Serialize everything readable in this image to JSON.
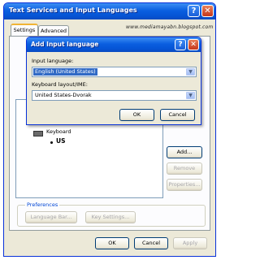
{
  "main_window": {
    "title": "Text Services and Input Languages",
    "help_glyph": "?",
    "close_glyph": "✕",
    "tabs": [
      {
        "label": "Settings",
        "active": true
      },
      {
        "label": "Advanced",
        "active": false
      }
    ],
    "watermark": "www.mediamayabn.blogspot.com",
    "installed_services": {
      "keyboard_label": "Keyboard",
      "layout_label": "US"
    },
    "side_buttons": [
      {
        "label": "Add...",
        "enabled": true
      },
      {
        "label": "Remove",
        "enabled": false
      },
      {
        "label": "Properties...",
        "enabled": false
      }
    ],
    "preferences": {
      "group_label": "Preferences",
      "language_bar_label": "Language Bar...",
      "key_settings_label": "Key Settings..."
    },
    "footer": {
      "ok_label": "OK",
      "cancel_label": "Cancel",
      "apply_label": "Apply"
    }
  },
  "dialog": {
    "title": "Add Input language",
    "help_glyph": "?",
    "close_glyph": "✕",
    "input_language_label": "Input language:",
    "input_language_value": "English (United States)",
    "keyboard_layout_label": "Keyboard layout/IME:",
    "keyboard_layout_value": "United States-Dvorak",
    "ok_label": "OK",
    "cancel_label": "Cancel"
  },
  "colors": {
    "titlebar": "#0a5fe0",
    "dialog_face": "#ece9d8",
    "selection": "#316ac5",
    "close_button": "#c4371c"
  },
  "icons": {
    "dropdown": "chevron-down-icon",
    "keyboard": "keyboard-icon"
  }
}
